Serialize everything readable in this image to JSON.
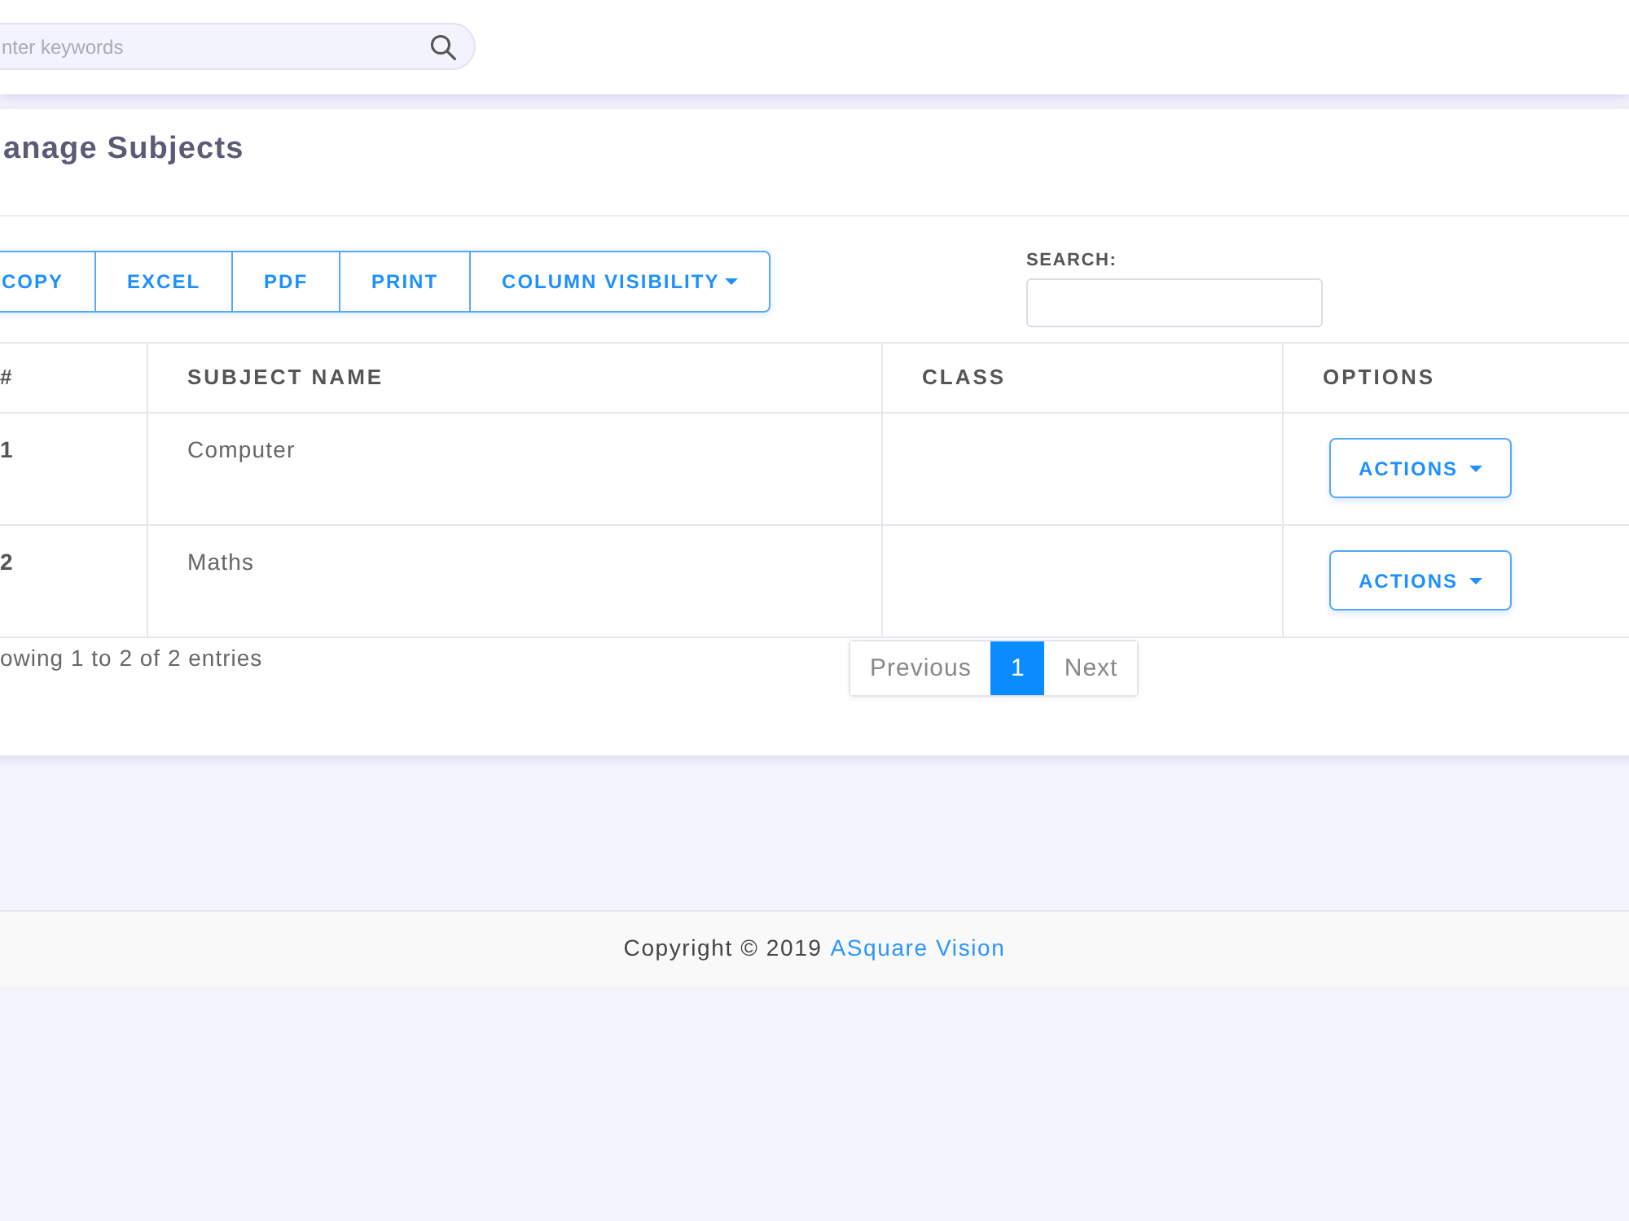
{
  "header": {
    "search": {
      "placeholder": "nter keywords"
    }
  },
  "card": {
    "title": "anage Subjects",
    "export_buttons": [
      {
        "label": "COPY",
        "kind": "button"
      },
      {
        "label": "EXCEL",
        "kind": "button"
      },
      {
        "label": "PDF",
        "kind": "button"
      },
      {
        "label": "PRINT",
        "kind": "button"
      },
      {
        "label": "COLUMN VISIBILITY",
        "kind": "dropdown"
      }
    ],
    "search": {
      "label": "SEARCH:"
    },
    "table": {
      "columns": [
        "#",
        "SUBJECT NAME",
        "CLASS",
        "OPTIONS"
      ],
      "rows": [
        {
          "number": "1",
          "subject_name": "Computer",
          "action": "ACTIONS"
        },
        {
          "number": "2",
          "subject_name": "Maths",
          "action": "ACTIONS"
        }
      ]
    },
    "info": "owing 1 to 2 of 2 entries",
    "pagination": {
      "previous": "Previous",
      "pages": [
        {
          "label": "1",
          "selected": true
        }
      ],
      "next": "Next"
    }
  },
  "footer": {
    "text": "Copyright © 2019",
    "link": "ASquare Vision"
  }
}
